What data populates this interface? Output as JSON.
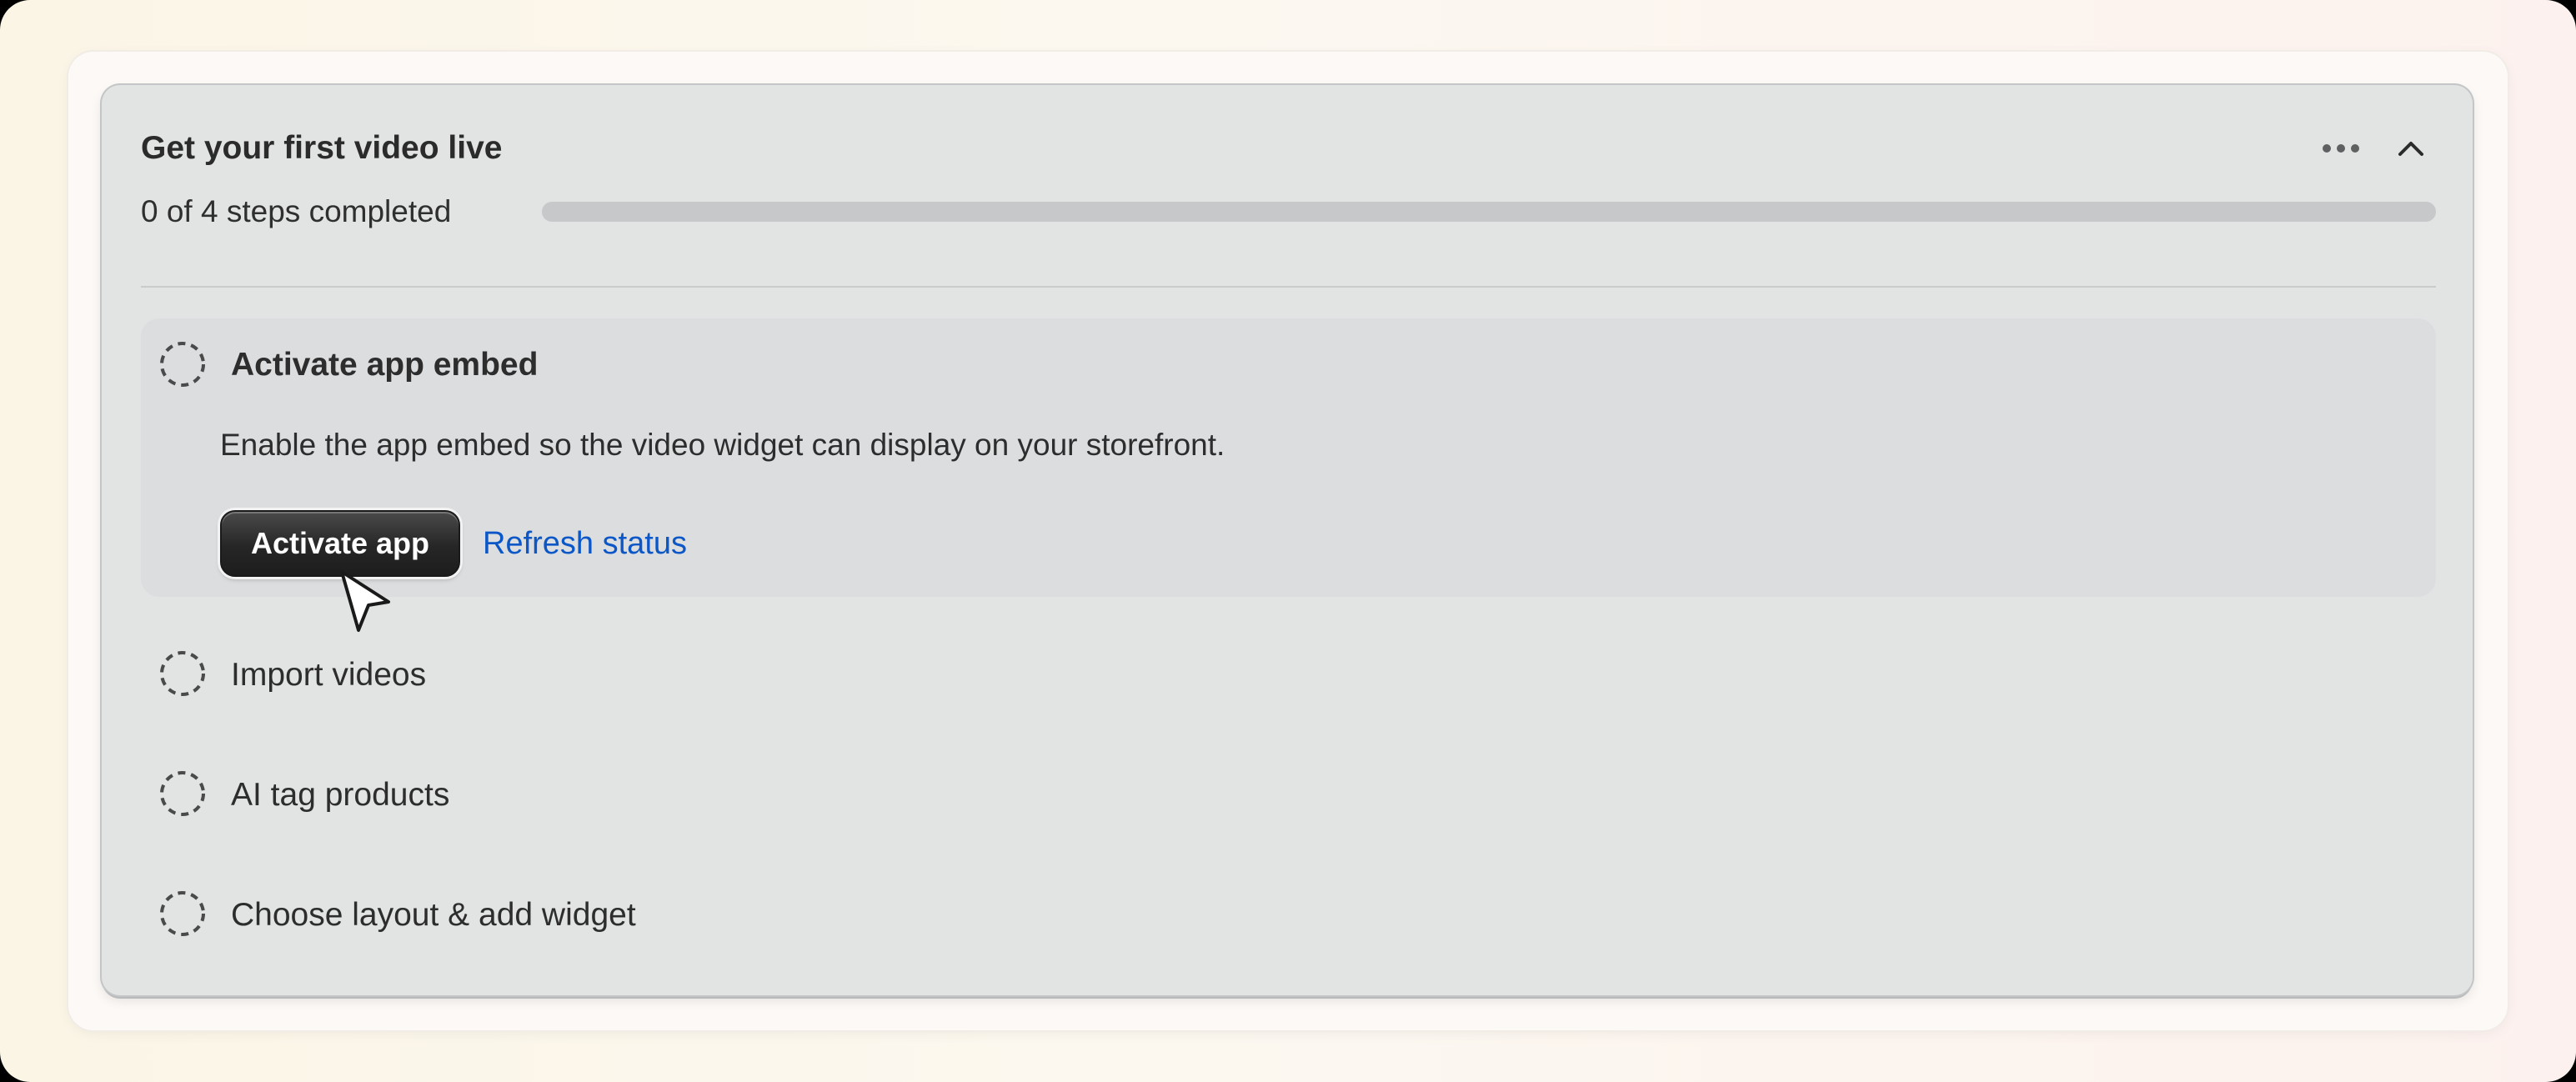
{
  "card": {
    "title": "Get your first video live",
    "progress": {
      "label": "0 of 4 steps completed",
      "completed": 0,
      "total": 4
    },
    "menu_icon": "more-horizontal-icon",
    "collapse_icon": "chevron-up-icon"
  },
  "steps": [
    {
      "title": "Activate app embed",
      "description": "Enable the app embed so the video widget can display on your storefront.",
      "primary_action": "Activate app",
      "secondary_action": "Refresh status",
      "expanded": true,
      "completed": false
    },
    {
      "title": "Import videos",
      "completed": false
    },
    {
      "title": "AI tag products",
      "completed": false
    },
    {
      "title": "Choose layout & add widget",
      "completed": false
    }
  ],
  "colors": {
    "card_background": "#e2e3e3",
    "active_step_background": "#dcdddf",
    "primary_button": "#262626",
    "link": "#0b57c8",
    "progress_track": "#c7c8c9"
  }
}
